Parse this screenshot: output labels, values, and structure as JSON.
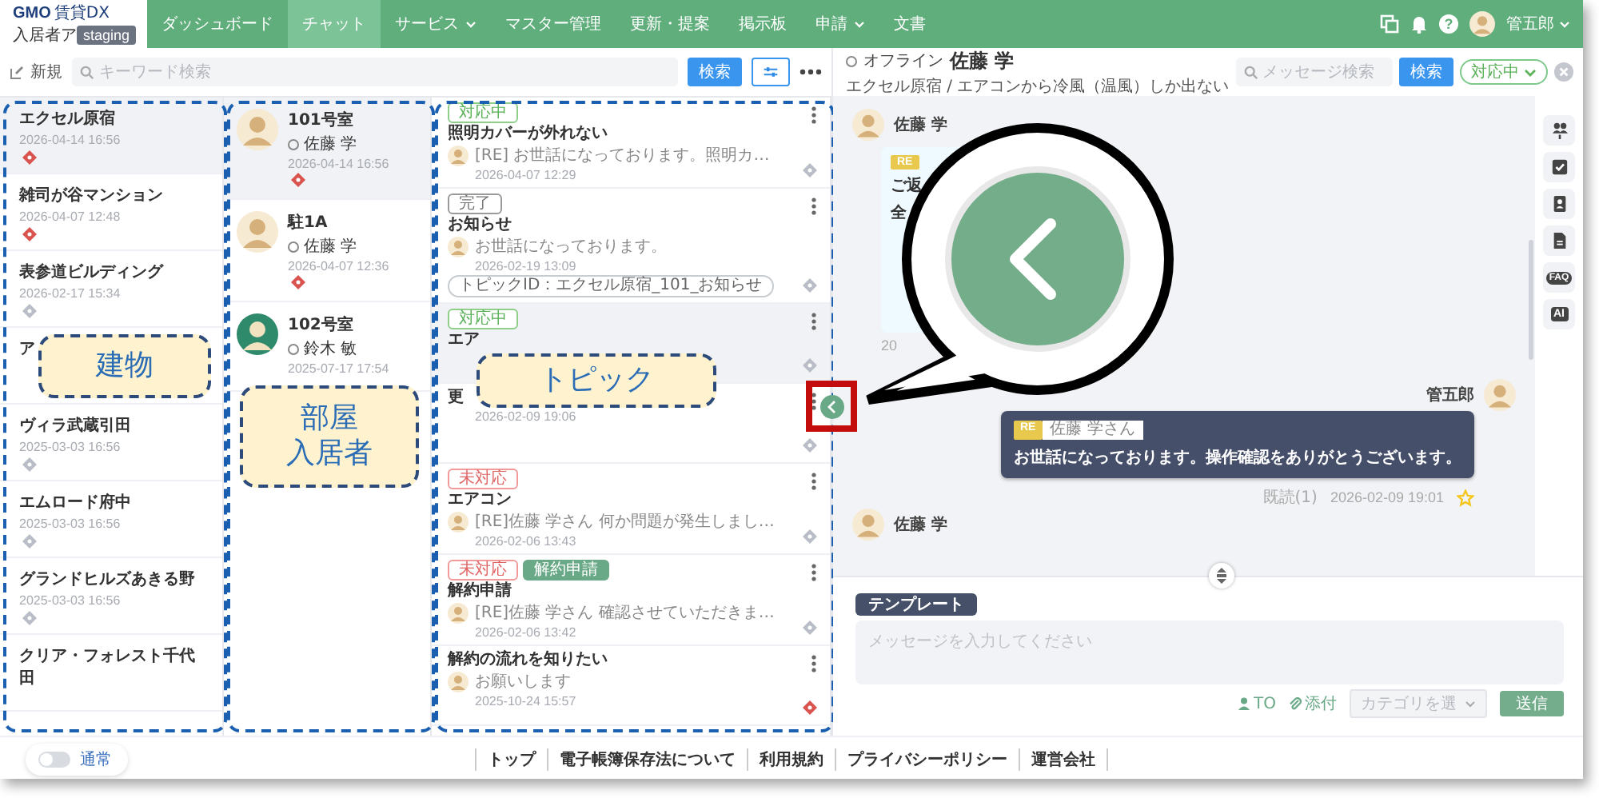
{
  "nav": {
    "logo": "GMO",
    "logo_suffix": "賃貸DX",
    "app_name": "入居者ア",
    "env_badge": "staging",
    "items": [
      {
        "label": "ダッシュボード",
        "selected": false,
        "dropdown": false
      },
      {
        "label": "チャット",
        "selected": true,
        "dropdown": false
      },
      {
        "label": "サービス",
        "selected": false,
        "dropdown": true
      },
      {
        "label": "マスター管理",
        "selected": false,
        "dropdown": false
      },
      {
        "label": "更新・提案",
        "selected": false,
        "dropdown": false
      },
      {
        "label": "掲示板",
        "selected": false,
        "dropdown": false
      },
      {
        "label": "申請",
        "selected": false,
        "dropdown": true
      },
      {
        "label": "文書",
        "selected": false,
        "dropdown": false
      }
    ],
    "help": "?",
    "user_name": "管五郎"
  },
  "toolbar": {
    "new_label": "新規",
    "search_placeholder": "キーワード検索",
    "search_button": "検索"
  },
  "buildings": [
    {
      "name": "エクセル原宿",
      "date": "2026-04-14 16:56",
      "alert": true,
      "selected": true
    },
    {
      "name": "雑司が谷マンション",
      "date": "2026-04-07 12:48",
      "alert": true,
      "selected": false
    },
    {
      "name": "表参道ビルディング",
      "date": "2026-02-17 15:34",
      "alert": false,
      "selected": false
    },
    {
      "name": "ア",
      "selected": false
    },
    {
      "name": "ヴィラ武蔵引田",
      "date": "2025-03-03 16:56",
      "alert": false,
      "selected": false
    },
    {
      "name": "エムロード府中",
      "date": "2025-03-03 16:56",
      "alert": false,
      "selected": false
    },
    {
      "name": "グランドヒルズあきる野",
      "date": "2025-03-03 16:56",
      "alert": false,
      "selected": false
    },
    {
      "name": "クリア・フォレスト千代田",
      "selected": false
    }
  ],
  "rooms": [
    {
      "room": "101号室",
      "tenant": "佐藤 学",
      "online": false,
      "date": "2026-04-14 16:56",
      "alert": true,
      "selected": true,
      "avatar_highlight": false
    },
    {
      "room": "駐1A",
      "tenant": "佐藤 学",
      "online": false,
      "date": "2026-04-07 12:36",
      "alert": true,
      "selected": false,
      "avatar_highlight": false
    },
    {
      "room": "102号室",
      "tenant": "鈴木 敏",
      "online": false,
      "date": "2025-07-17 17:54",
      "selected": false,
      "avatar_highlight": true
    }
  ],
  "topics": [
    {
      "tags": [
        {
          "label": "対応中",
          "kind": "open"
        }
      ],
      "title": "照明カバーが外れない",
      "preview": "[RE] お世話になっております。照明カ…",
      "date": "2026-04-07 12:29",
      "alert": false,
      "selected": false
    },
    {
      "tags": [
        {
          "label": "完了",
          "kind": "done"
        }
      ],
      "title": "お知らせ",
      "preview": "お世話になっております。",
      "date": "2026-02-19 13:09",
      "alert": false,
      "selected": false,
      "topic_id": "トピックID：エクセル原宿_101_お知らせ"
    },
    {
      "tags": [
        {
          "label": "対応中",
          "kind": "open"
        }
      ],
      "title": "エア",
      "alert": false,
      "selected": true
    },
    {
      "title": "更",
      "date": "2026-02-09 19:06",
      "alert": false,
      "selected": false
    },
    {
      "tags": [
        {
          "label": "未対応",
          "kind": "todo"
        }
      ],
      "title": "エアコン",
      "preview": "[RE]佐藤 学さん 何か問題が発生しまし…",
      "date": "2026-02-06 13:43",
      "alert": false,
      "selected": false
    },
    {
      "tags": [
        {
          "label": "未対応",
          "kind": "todo"
        },
        {
          "label": "解約申請",
          "kind": "request"
        }
      ],
      "title": "解約申請",
      "preview": "[RE]佐藤 学さん 確認させていただきま…",
      "date": "2026-02-06 13:42",
      "alert": false,
      "selected": false
    },
    {
      "title": "解約の流れを知りたい",
      "preview": "お願いします",
      "date": "2025-10-24 15:57",
      "alert": true,
      "selected": false
    }
  ],
  "chat": {
    "presence": "オフライン",
    "online": false,
    "name": "佐藤 学",
    "subtitle": "エクセル原宿 / エアコンから冷風（温風）しか出ない",
    "search_placeholder": "メッセージ検索",
    "search_button": "検索",
    "status": "対応中",
    "messages": [
      {
        "kind": "incoming",
        "sender": "佐藤 学",
        "reply_tag": "RE",
        "lines": [
          "ご返",
          "全"
        ],
        "time": "20"
      },
      {
        "kind": "outgoing",
        "sender": "管五郎",
        "reply_tag": "RE",
        "reply_to": "佐藤 学さん",
        "text": "お世話になっております。操作確認をありがとうございます。",
        "read": "既読(1)",
        "time": "2026-02-09 19:01",
        "starred": false
      },
      {
        "kind": "incoming",
        "sender": "佐藤 学"
      }
    ],
    "rail": [
      {
        "kind": "people"
      },
      {
        "kind": "check"
      },
      {
        "kind": "contact"
      },
      {
        "kind": "document"
      },
      {
        "kind": "faq",
        "label": "FAQ"
      },
      {
        "kind": "ai",
        "label": "AI"
      }
    ],
    "composer": {
      "tab": "テンプレート",
      "placeholder": "メッセージを入力してください",
      "to": "TO",
      "attach": "添付",
      "category": "カテゴリを選",
      "send": "送信"
    }
  },
  "mode_toggle": {
    "label": "通常",
    "on": false
  },
  "footer_links": [
    "トップ",
    "電子帳簿保存法について",
    "利用規約",
    "プライバシーポリシー",
    "運営会社"
  ],
  "annotations": [
    {
      "lines": [
        "建物"
      ]
    },
    {
      "lines": [
        "部屋",
        "入居者"
      ]
    },
    {
      "lines": [
        "トピック"
      ]
    }
  ]
}
